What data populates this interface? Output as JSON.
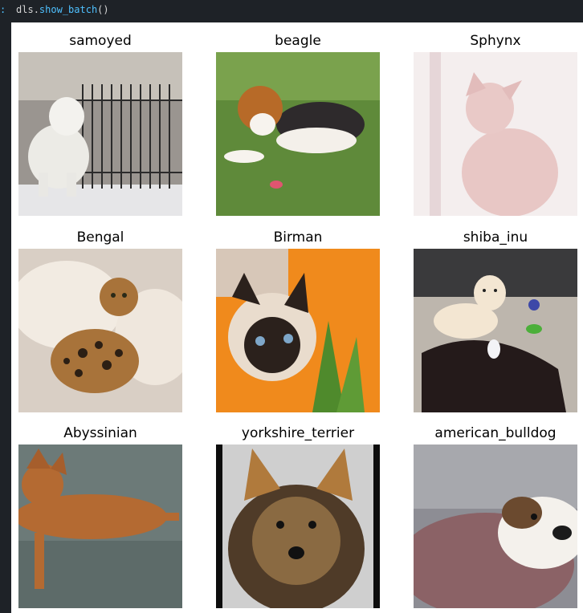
{
  "cell": {
    "prompt": ":",
    "code_object": "dls",
    "code_dot": ".",
    "code_function": "show_batch",
    "code_parens": "()"
  },
  "batch": [
    {
      "label": "samoyed"
    },
    {
      "label": "beagle"
    },
    {
      "label": "Sphynx"
    },
    {
      "label": "Bengal"
    },
    {
      "label": "Birman"
    },
    {
      "label": "shiba_inu"
    },
    {
      "label": "Abyssinian"
    },
    {
      "label": "yorkshire_terrier"
    },
    {
      "label": "american_bulldog"
    }
  ],
  "colors": {
    "editor_bg": "#1e2227",
    "function_token": "#4fc1ff",
    "text_token": "#d4d4d4",
    "output_bg": "#ffffff"
  }
}
